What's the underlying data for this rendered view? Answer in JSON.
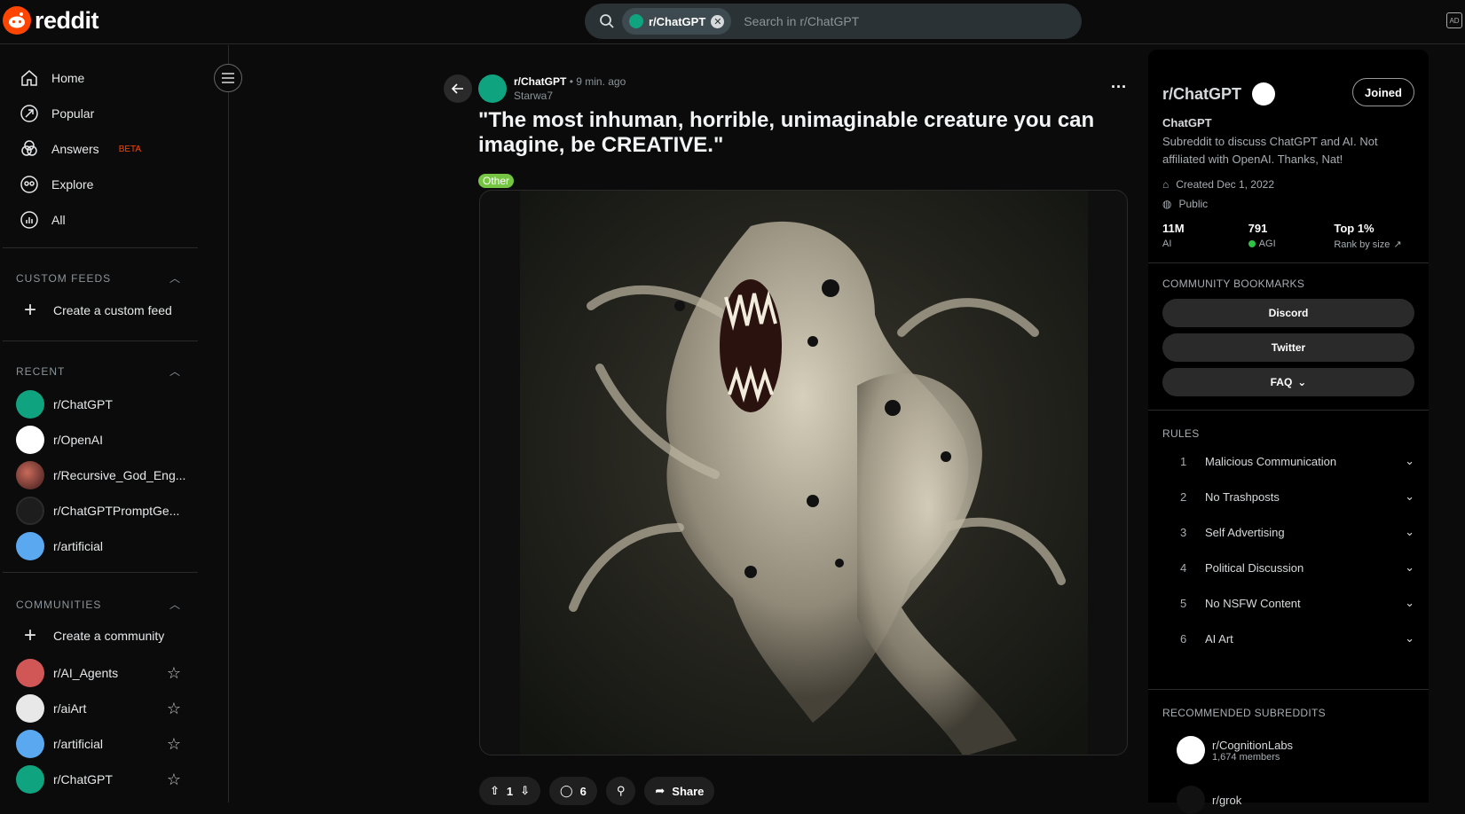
{
  "header": {
    "logo_text": "reddit",
    "search_chip": "r/ChatGPT",
    "search_placeholder": "Search in r/ChatGPT",
    "ad_label": "AD"
  },
  "sidebar": {
    "nav": [
      {
        "label": "Home",
        "icon": "home-icon"
      },
      {
        "label": "Popular",
        "icon": "popular-icon"
      },
      {
        "label": "Answers",
        "icon": "answers-icon",
        "badge": "BETA"
      },
      {
        "label": "Explore",
        "icon": "explore-icon"
      },
      {
        "label": "All",
        "icon": "all-icon"
      }
    ],
    "custom_feeds_title": "CUSTOM FEEDS",
    "create_feed": "Create a custom feed",
    "recent_title": "RECENT",
    "recent": [
      "r/ChatGPT",
      "r/OpenAI",
      "r/Recursive_God_Eng...",
      "r/ChatGPTPromptGe...",
      "r/artificial"
    ],
    "communities_title": "COMMUNITIES",
    "create_community": "Create a community",
    "communities": [
      "r/AI_Agents",
      "r/aiArt",
      "r/artificial",
      "r/ChatGPT"
    ]
  },
  "post": {
    "subreddit": "r/ChatGPT",
    "time": "• 9 min. ago",
    "author": "Starwa7",
    "title": "\"The most inhuman, horrible, unimaginable creature you can imagine, be CREATIVE.\"",
    "flair": "Other",
    "votes": "1",
    "comments": "6",
    "share_label": "Share"
  },
  "community": {
    "title": "r/ChatGPT",
    "joined_label": "Joined",
    "name": "ChatGPT",
    "description": "Subreddit to discuss ChatGPT and AI. Not affiliated with OpenAI. Thanks, Nat!",
    "created": "Created Dec 1, 2022",
    "visibility": "Public",
    "stats": [
      {
        "value": "11M",
        "label": "AI"
      },
      {
        "value": "791",
        "label": "AGI"
      },
      {
        "value": "Top 1%",
        "label": "Rank by size"
      }
    ],
    "bookmarks_title": "COMMUNITY BOOKMARKS",
    "bookmarks": [
      "Discord",
      "Twitter",
      "FAQ"
    ],
    "rules_title": "RULES",
    "rules": [
      {
        "num": "1",
        "text": "Malicious Communication"
      },
      {
        "num": "2",
        "text": "No Trashposts"
      },
      {
        "num": "3",
        "text": "Self Advertising"
      },
      {
        "num": "4",
        "text": "Political Discussion"
      },
      {
        "num": "5",
        "text": "No NSFW Content"
      },
      {
        "num": "6",
        "text": "AI Art"
      }
    ],
    "recommended_title": "RECOMMENDED SUBREDDITS",
    "recommended": [
      {
        "name": "r/CognitionLabs",
        "members": "1,674 members"
      },
      {
        "name": "r/grok",
        "members": ""
      }
    ]
  },
  "colors": {
    "accent": "#ff4500",
    "chatgpt_green": "#10a37f",
    "flair_green": "#75c442",
    "online_dot": "#2ec246"
  }
}
